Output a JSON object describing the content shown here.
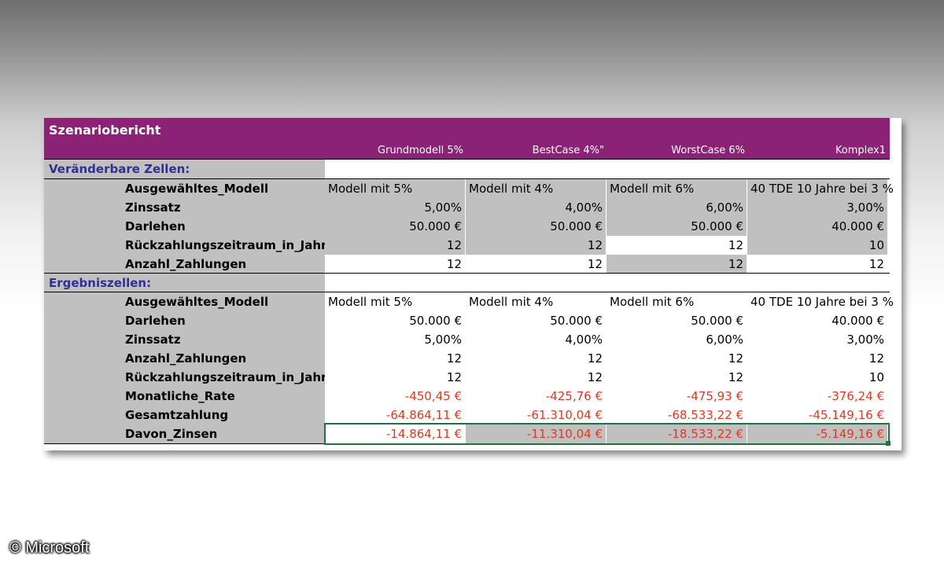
{
  "title": "Szenariobericht",
  "scenarios": [
    "Grundmodell 5%",
    "BestCase 4%\"",
    "WorstCase 6%",
    "Komplex1"
  ],
  "sections": {
    "changing": "Veränderbare Zellen:",
    "results": "Ergebniszellen:"
  },
  "changing_rows": [
    {
      "label": "Ausgewähltes_Modell",
      "values": [
        "Modell mit 5%",
        "Modell mit 4%",
        "Modell mit 6%",
        "40 TDE 10 Jahre bei 3 %"
      ]
    },
    {
      "label": "Zinssatz",
      "values": [
        "5,00%",
        "4,00%",
        "6,00%",
        "3,00%"
      ]
    },
    {
      "label": "Darlehen",
      "values": [
        "50.000 €",
        "50.000 €",
        "50.000 €",
        "40.000 €"
      ]
    },
    {
      "label": "Rückzahlungszeitraum_in_Jahren",
      "values": [
        "12",
        "12",
        "12",
        "10"
      ]
    },
    {
      "label": "Anzahl_Zahlungen",
      "values": [
        "12",
        "12",
        "12",
        "12"
      ]
    }
  ],
  "result_rows": [
    {
      "label": "Ausgewähltes_Modell",
      "values": [
        "Modell mit 5%",
        "Modell mit 4%",
        "Modell mit 6%",
        "40 TDE 10 Jahre bei 3 %"
      ]
    },
    {
      "label": "Darlehen",
      "values": [
        "50.000 €",
        "50.000 €",
        "50.000 €",
        "40.000 €"
      ]
    },
    {
      "label": "Zinssatz",
      "values": [
        "5,00%",
        "4,00%",
        "6,00%",
        "3,00%"
      ]
    },
    {
      "label": "Anzahl_Zahlungen",
      "values": [
        "12",
        "12",
        "12",
        "12"
      ]
    },
    {
      "label": "Rückzahlungszeitraum_in_Jahren",
      "values": [
        "12",
        "12",
        "12",
        "10"
      ]
    },
    {
      "label": "Monatliche_Rate",
      "values": [
        "-450,45 €",
        "-425,76 €",
        "-475,93 €",
        "-376,24 €"
      ]
    },
    {
      "label": "Gesamtzahlung",
      "values": [
        "-64.864,11 €",
        "-61.310,04 €",
        "-68.533,22 €",
        "-45.149,16 €"
      ]
    },
    {
      "label": "Davon_Zinsen",
      "values": [
        "-14.864,11 €",
        "-11.310,04 €",
        "-18.533,22 €",
        "-5.149,16 €"
      ]
    }
  ],
  "copyright": "© Microsoft",
  "colors": {
    "header": "#8b2275",
    "section_text": "#2e3192",
    "negative": "#e03a1e",
    "selection": "#1f7244"
  }
}
